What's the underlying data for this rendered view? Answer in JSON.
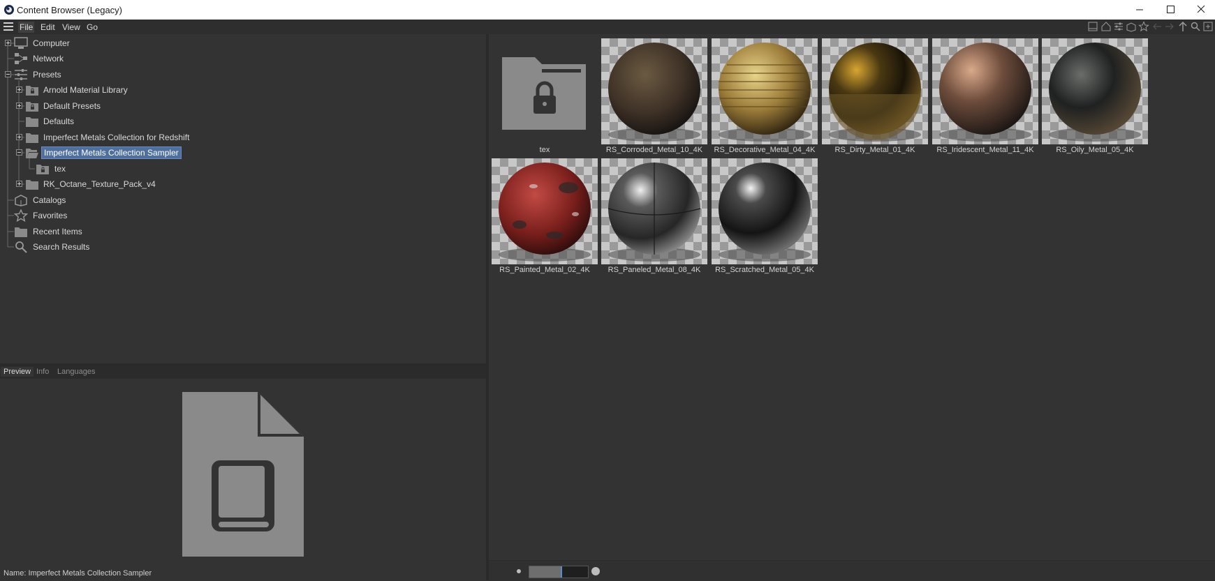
{
  "window": {
    "title": "Content Browser (Legacy)",
    "minimize": "—",
    "maximize": "☐",
    "close": "✕"
  },
  "menu": {
    "items": [
      "File",
      "Edit",
      "View",
      "Go"
    ]
  },
  "toolbar": {
    "icons": [
      "layout-icon",
      "home-icon",
      "settings-icon",
      "catalog-icon",
      "star-icon",
      "back-icon",
      "forward-icon",
      "up-icon",
      "search-icon",
      "new-icon"
    ]
  },
  "tree": {
    "items": [
      {
        "label": "Computer",
        "icon": "computer-icon"
      },
      {
        "label": "Network",
        "icon": "network-icon"
      },
      {
        "label": "Presets",
        "icon": "presets-icon"
      },
      {
        "label": "Arnold Material Library",
        "icon": "folder-lock-icon"
      },
      {
        "label": "Default Presets",
        "icon": "folder-lock-icon"
      },
      {
        "label": "Defaults",
        "icon": "folder-icon"
      },
      {
        "label": "Imperfect Metals Collection for Redshift",
        "icon": "folder-icon"
      },
      {
        "label": "Imperfect Metals Collection Sampler",
        "icon": "folder-open-icon"
      },
      {
        "label": "tex",
        "icon": "folder-lock-icon"
      },
      {
        "label": "RK_Octane_Texture_Pack_v4",
        "icon": "folder-icon"
      },
      {
        "label": "Catalogs",
        "icon": "catalog-icon"
      },
      {
        "label": "Favorites",
        "icon": "star-icon"
      },
      {
        "label": "Recent Items",
        "icon": "folder-icon"
      },
      {
        "label": "Search Results",
        "icon": "search-icon"
      }
    ]
  },
  "tabs": [
    "Preview",
    "Info",
    "Languages"
  ],
  "preview": {
    "name_line": "Name: Imperfect Metals Collection Sampler"
  },
  "grid": {
    "items": [
      {
        "label": "tex",
        "kind": "folder"
      },
      {
        "label": "RS_Corroded_Metal_10_4K",
        "kind": "material"
      },
      {
        "label": "RS_Decorative_Metal_04_4K",
        "kind": "material"
      },
      {
        "label": "RS_Dirty_Metal_01_4K",
        "kind": "material"
      },
      {
        "label": "RS_Iridescent_Metal_11_4K",
        "kind": "material"
      },
      {
        "label": "RS_Oily_Metal_05_4K",
        "kind": "material"
      },
      {
        "label": "RS_Painted_Metal_02_4K",
        "kind": "material"
      },
      {
        "label": "RS_Paneled_Metal_08_4K",
        "kind": "material"
      },
      {
        "label": "RS_Scratched_Metal_05_4K",
        "kind": "material"
      }
    ]
  },
  "zoom": {
    "level": 0.55
  },
  "colors": {
    "selection": "#4f6f9e",
    "background": "#333333",
    "icon": "#8a8a8a"
  }
}
